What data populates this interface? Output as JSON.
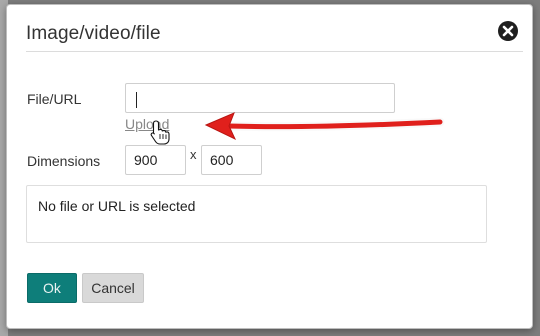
{
  "dialog": {
    "title": "Image/video/file",
    "close_icon": "close-circle-icon"
  },
  "file": {
    "label": "File/URL",
    "value": "",
    "upload_label": "Upload"
  },
  "dimensions": {
    "label": "Dimensions",
    "width": "900",
    "separator": "x",
    "height": "600"
  },
  "status": {
    "message": "No file or URL is selected"
  },
  "actions": {
    "ok_label": "Ok",
    "cancel_label": "Cancel"
  },
  "annotation": {
    "arrow_icon": "red-arrow-icon",
    "cursor_icon": "hand-pointer-icon",
    "arrow_color": "#e0201c"
  },
  "colors": {
    "ok_button": "#0e7e7a",
    "cancel_button": "#d9d9d9"
  }
}
